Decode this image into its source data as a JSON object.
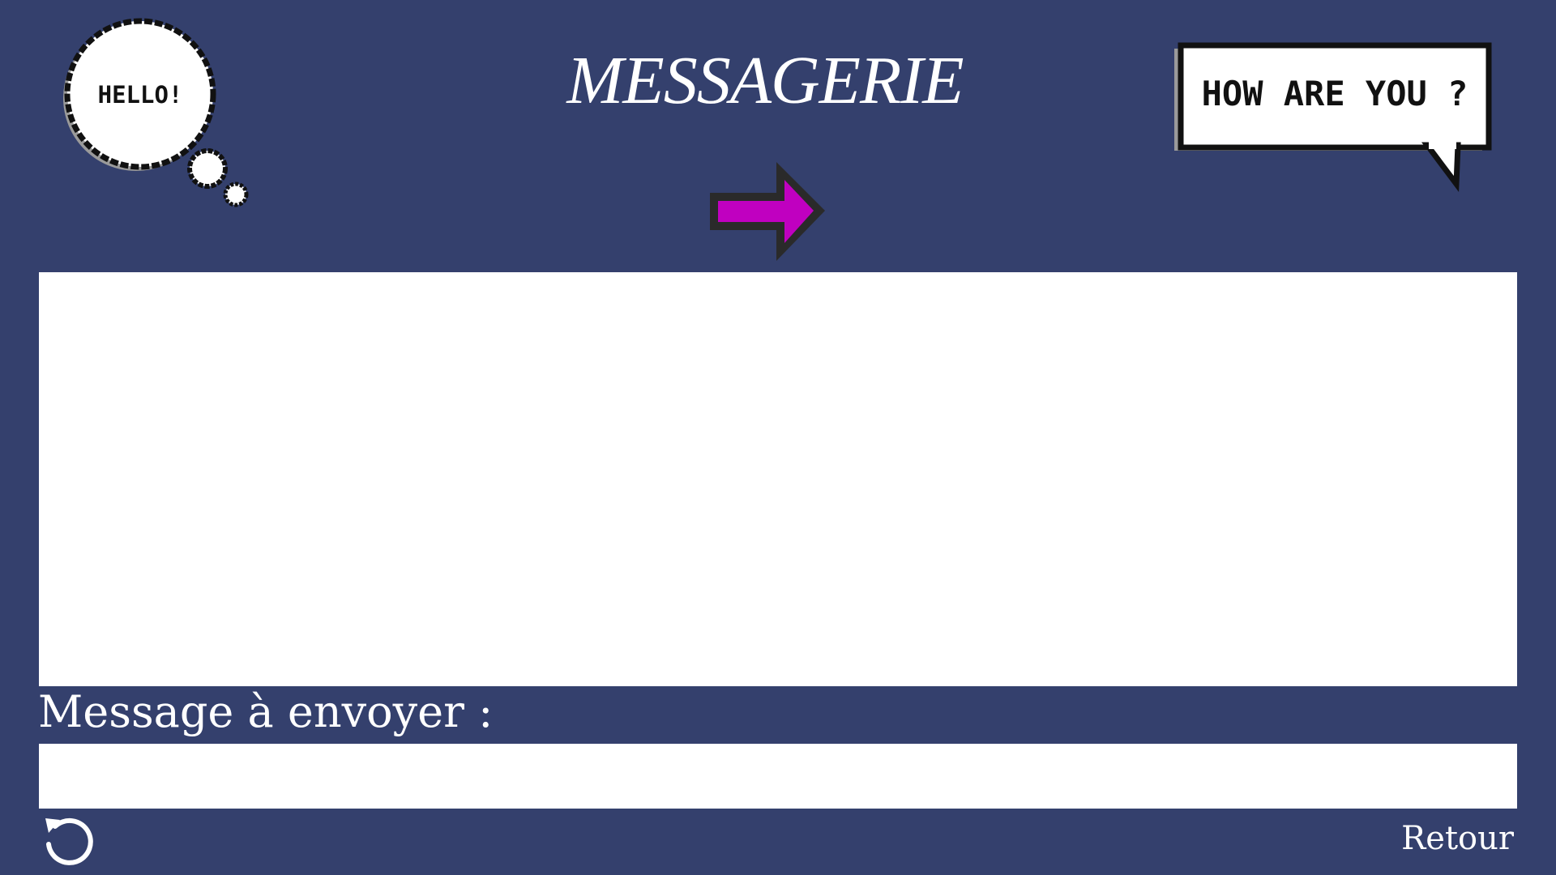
{
  "header": {
    "title": "MESSAGERIE",
    "thought_bubble_text": "HELLO!",
    "speech_bubble_text": "HOW ARE YOU ?"
  },
  "send_arrow": {
    "icon": "pixel-arrow-right-icon",
    "color": "#c000c0"
  },
  "messages": {
    "content": ""
  },
  "compose": {
    "label": "Message à envoyer :",
    "value": ""
  },
  "footer": {
    "refresh_icon": "refresh-icon",
    "back_label": "Retour"
  },
  "colors": {
    "background": "#34406d",
    "panel": "#ffffff",
    "accent": "#c000c0"
  }
}
